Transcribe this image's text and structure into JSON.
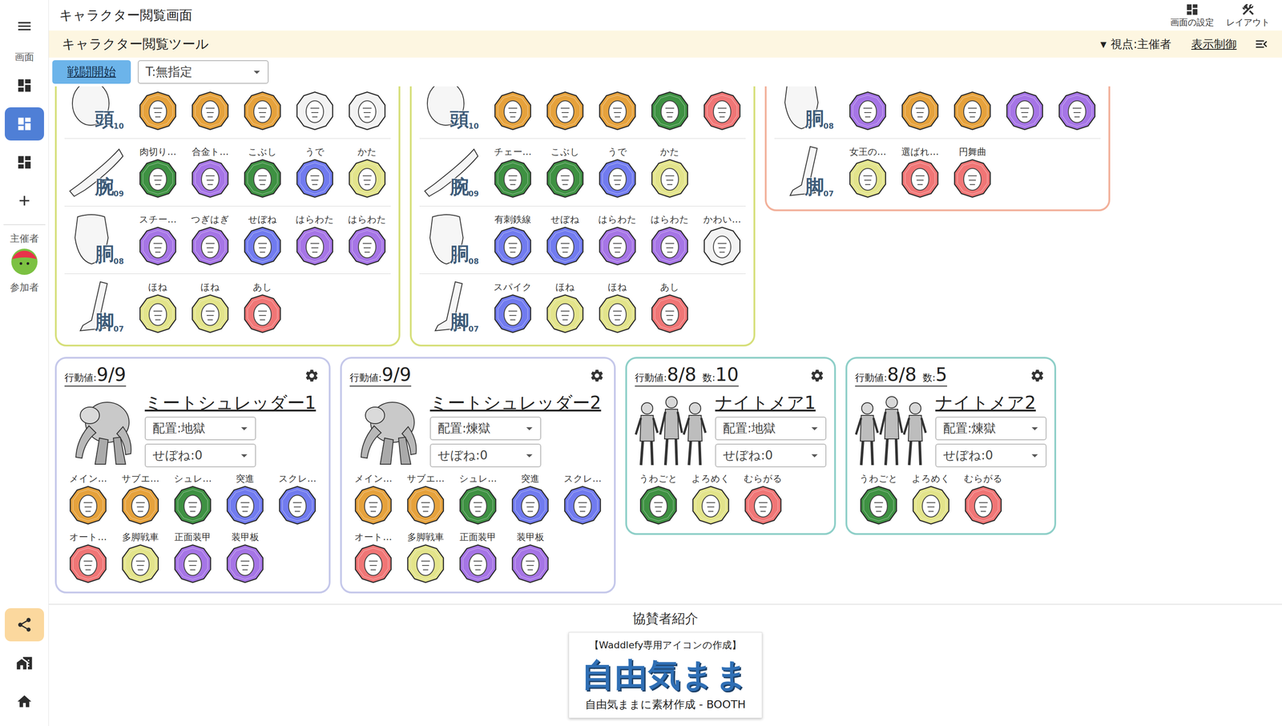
{
  "window": {
    "title": "キャラクター閲覧画面"
  },
  "header_actions": [
    {
      "label": "画面の設定"
    },
    {
      "label": "レイアウト"
    }
  ],
  "sidebar": {
    "screen_label": "画面",
    "screens": [
      {
        "selected": false
      },
      {
        "selected": true
      },
      {
        "selected": false
      }
    ],
    "host_label": "主催者",
    "participant_label": "参加者",
    "bottom": [
      {
        "highlighted": true
      },
      {
        "highlighted": false
      },
      {
        "highlighted": false
      }
    ]
  },
  "tool_bar": {
    "title": "キャラクター閲覧ツール",
    "view_marker": "▼",
    "view": "視点:主催者",
    "display_control": "表示制御"
  },
  "action_bar": {
    "battle_button": "戦闘開始",
    "target_select": "T:無指定"
  },
  "part_cards": [
    {
      "color": "#d6df7a",
      "rows": [
        {
          "kind": "head",
          "part": "頭",
          "number": "10",
          "items": [
            {
              "color": "#e6a23c"
            },
            {
              "color": "#e6a23c"
            },
            {
              "color": "#e6a23c"
            },
            {
              "color": "#f2f2f2"
            },
            {
              "color": "#f2f2f2"
            }
          ]
        },
        {
          "kind": "arm",
          "part": "腕",
          "number": "09",
          "items": [
            {
              "name": "肉切り…",
              "color": "#3e9142"
            },
            {
              "name": "合金ト…",
              "color": "#a675e6"
            },
            {
              "name": "こぶし",
              "color": "#3e9142"
            },
            {
              "name": "うで",
              "color": "#717bef"
            },
            {
              "name": "かた",
              "color": "#e3e48b"
            }
          ]
        },
        {
          "kind": "torso",
          "part": "胴",
          "number": "08",
          "items": [
            {
              "name": "スチー…",
              "color": "#a675e6"
            },
            {
              "name": "つぎはぎ",
              "color": "#a675e6"
            },
            {
              "name": "せぼね",
              "color": "#717bef"
            },
            {
              "name": "はらわた",
              "color": "#a675e6"
            },
            {
              "name": "はらわた",
              "color": "#a675e6"
            }
          ]
        },
        {
          "kind": "leg",
          "part": "脚",
          "number": "07",
          "items": [
            {
              "name": "ほね",
              "color": "#e3e48b"
            },
            {
              "name": "ほね",
              "color": "#e3e48b"
            },
            {
              "name": "あし",
              "color": "#f07676"
            }
          ]
        }
      ]
    },
    {
      "color": "#d6df7a",
      "rows": [
        {
          "kind": "head",
          "part": "頭",
          "number": "10",
          "items": [
            {
              "color": "#e6a23c"
            },
            {
              "color": "#e6a23c"
            },
            {
              "color": "#e6a23c"
            },
            {
              "color": "#3e9142"
            },
            {
              "color": "#f07676"
            }
          ]
        },
        {
          "kind": "arm",
          "part": "腕",
          "number": "09",
          "items": [
            {
              "name": "チェー…",
              "color": "#3e9142"
            },
            {
              "name": "こぶし",
              "color": "#3e9142"
            },
            {
              "name": "うで",
              "color": "#717bef"
            },
            {
              "name": "かた",
              "color": "#e3e48b"
            }
          ]
        },
        {
          "kind": "torso",
          "part": "胴",
          "number": "08",
          "items": [
            {
              "name": "有刺鉄線",
              "color": "#717bef"
            },
            {
              "name": "せぼね",
              "color": "#717bef"
            },
            {
              "name": "はらわた",
              "color": "#a675e6"
            },
            {
              "name": "はらわた",
              "color": "#a675e6"
            },
            {
              "name": "かわい…",
              "color": "#f2f2f2"
            }
          ]
        },
        {
          "kind": "leg",
          "part": "脚",
          "number": "07",
          "items": [
            {
              "name": "スパイク",
              "color": "#717bef"
            },
            {
              "name": "ほね",
              "color": "#e3e48b"
            },
            {
              "name": "ほね",
              "color": "#e3e48b"
            },
            {
              "name": "あし",
              "color": "#f07676"
            }
          ]
        }
      ]
    },
    {
      "color": "#f2b09a",
      "rows": [
        {
          "kind": "torso",
          "part": "胴",
          "number": "08",
          "items": [
            {
              "color": "#a675e6"
            },
            {
              "color": "#e6a23c"
            },
            {
              "color": "#e6a23c"
            },
            {
              "color": "#a675e6"
            },
            {
              "color": "#a675e6"
            }
          ]
        },
        {
          "kind": "leg",
          "part": "脚",
          "number": "07",
          "items": [
            {
              "name": "女王の…",
              "color": "#e3e48b"
            },
            {
              "name": "選ばれ…",
              "color": "#f07676"
            },
            {
              "name": "円舞曲",
              "color": "#f07676"
            }
          ]
        }
      ]
    }
  ],
  "characters": [
    {
      "kind": "shredder",
      "color": "#c5c8ea",
      "action_label": "行動値:",
      "action": "9/9",
      "name": "ミートシュレッダー1",
      "placement": "配置:地獄",
      "spine": "せぼね:0",
      "parts": [
        {
          "name": "メイン…",
          "color": "#e6a23c"
        },
        {
          "name": "サブエ…",
          "color": "#e6a23c"
        },
        {
          "name": "シュレ…",
          "color": "#3e9142"
        },
        {
          "name": "突進",
          "color": "#717bef"
        },
        {
          "name": "スクレ…",
          "color": "#717bef"
        },
        {
          "name": "オート…",
          "color": "#f07676"
        },
        {
          "name": "多脚戦車",
          "color": "#e3e48b"
        },
        {
          "name": "正面装甲",
          "color": "#a675e6"
        },
        {
          "name": "装甲板",
          "color": "#a675e6"
        }
      ]
    },
    {
      "kind": "shredder",
      "color": "#c5c8ea",
      "action_label": "行動値:",
      "action": "9/9",
      "name": "ミートシュレッダー2",
      "placement": "配置:煉獄",
      "spine": "せぼね:0",
      "parts": [
        {
          "name": "メイン…",
          "color": "#e6a23c"
        },
        {
          "name": "サブエ…",
          "color": "#e6a23c"
        },
        {
          "name": "シュレ…",
          "color": "#3e9142"
        },
        {
          "name": "突進",
          "color": "#717bef"
        },
        {
          "name": "スクレ…",
          "color": "#717bef"
        },
        {
          "name": "オート…",
          "color": "#f07676"
        },
        {
          "name": "多脚戦車",
          "color": "#e3e48b"
        },
        {
          "name": "正面装甲",
          "color": "#a675e6"
        },
        {
          "name": "装甲板",
          "color": "#a675e6"
        }
      ]
    },
    {
      "kind": "nightmare",
      "color": "#8ecfc8",
      "action_label": "行動値:",
      "action": "8/8",
      "count_label": "数:",
      "count": "10",
      "name": "ナイトメア1",
      "placement": "配置:地獄",
      "spine": "せぼね:0",
      "parts": [
        {
          "name": "うわごと",
          "color": "#3e9142"
        },
        {
          "name": "よろめく",
          "color": "#e3e48b"
        },
        {
          "name": "むらがる",
          "color": "#f07676"
        }
      ]
    },
    {
      "kind": "nightmare",
      "color": "#8ecfc8",
      "action_label": "行動値:",
      "action": "8/8",
      "count_label": "数:",
      "count": "5",
      "name": "ナイトメア2",
      "placement": "配置:煉獄",
      "spine": "せぼね:0",
      "parts": [
        {
          "name": "うわごと",
          "color": "#3e9142"
        },
        {
          "name": "よろめく",
          "color": "#e3e48b"
        },
        {
          "name": "むらがる",
          "color": "#f07676"
        }
      ]
    }
  ],
  "sponsor": {
    "heading": "協賛者紹介",
    "banner": {
      "caption_top": "【Waddlefy専用アイコンの作成】",
      "logo": "自由気まま",
      "caption_bottom": "自由気ままに素材作成 - BOOTH"
    }
  }
}
